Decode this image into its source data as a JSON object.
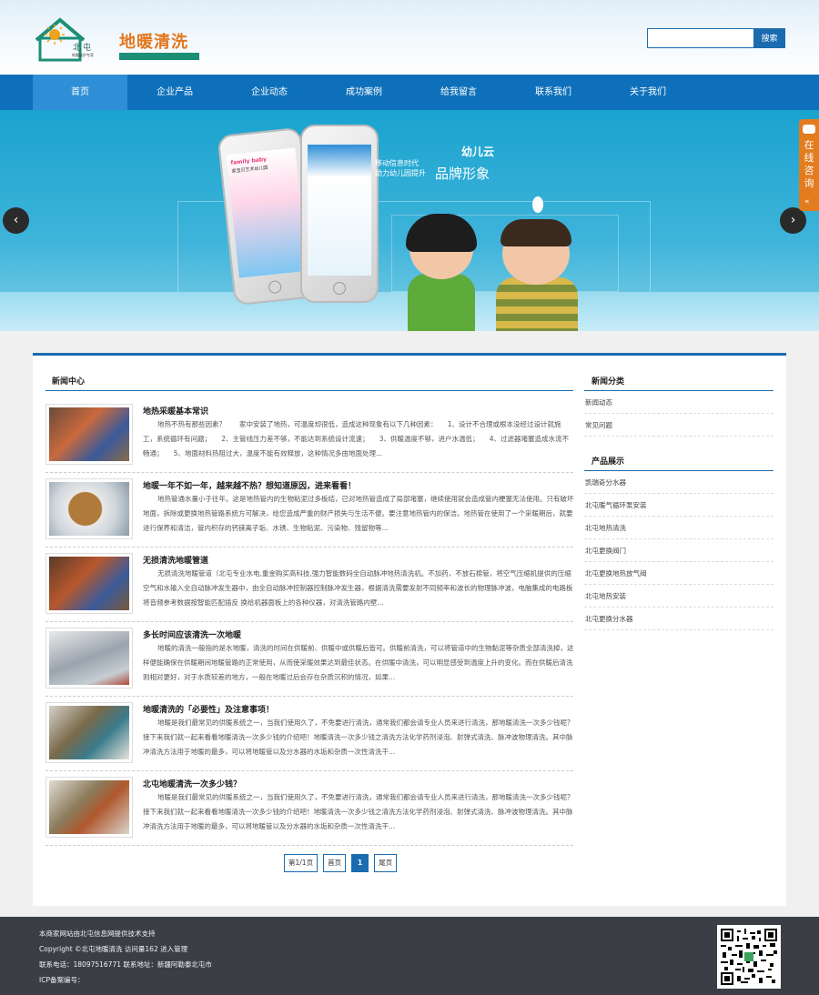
{
  "header": {
    "logo_text": "北屯",
    "logo_subtext": "地暖维护专家",
    "brand": "地暖清洗",
    "search": {
      "placeholder": "",
      "button_label": "搜索"
    }
  },
  "nav": {
    "items": [
      "首页",
      "企业产品",
      "企业动态",
      "成功案例",
      "给我留言",
      "联系我们",
      "关于我们"
    ],
    "active": "首页"
  },
  "banner": {
    "brand": "幼儿云",
    "slogan_line1": "移动信息时代",
    "slogan_line2": "助力幼儿园提升",
    "slogan_highlight": "品牌形象",
    "phone_title": "family baby",
    "phone_subtitle": "家宝贝艺术幼儿园"
  },
  "consult": {
    "label": "在线咨询",
    "arrow": "«"
  },
  "news_section": {
    "title": "新闻中心"
  },
  "news": [
    {
      "title": "地热采暖基本常识",
      "desc": "地热不热有那些因素？　　家中安装了地热，可温度却很低，造成这种现象有以下几种因素：　　1、设计不合理或根本没经过设计就施工，系统循环有问题；　　2、主管线压力差不够，不能达到系统设计流速；　　3、供暖温度不够，进户水温低；　　4、过滤器堵塞造成水流不畅通；　　5、地面材料热阻过大，温度不能有效释放，这种情况多由地面处理..."
    },
    {
      "title": "地暖一年不如一年，越来越不热？想知道原因，进来看看！",
      "desc": "地热管通水量小于往年。这是地热管内的生物粘泥过多板结，已对地热管造成了局部堵塞，继续使用就会造成管内梗塞无法使用。只有破坏地面，拆除或更换地热管路系统方可解决，给您造成严重的财产损失与生活不便。要注意地热管内的保洁。地热管在使用了一个采暖期后，就要进行保养和清洁，管内积存的钙镁离子垢、水锈、生物粘泥、污染物、残留物等..."
    },
    {
      "title": "无损清洗地暖管道",
      "desc": "无损清洗地暖管道（北屯专业水电,重金购买高科技,强力智能数码全自动脉冲地热清洗机。不加药，不放石棉管，将空气压缩机提供的压缩空气和水输入全自动脉冲发生器中，由全自动脉冲控制器控制脉冲发生器，根据清洗需要发射不同频率和波长的物理脉冲波，电脑集成的电路板将音频参考数据按智能匹配插反 换给机器面板上的各种仪器，对清洗管路内壁..."
    },
    {
      "title": "多长时间应该清洗一次地暖",
      "desc": "地暖的清洗一般指的是水地暖，清洗的时间在供暖前、供暖中或供暖后皆可。供暖前清洗，可以将管道中的生物黏泥等杂质全部清洗掉，这样便能确保在供暖期间地暖管路的正常使用，从而使采暖效果达到最佳状态。在供暖中清洗，可以明显感受到温度上升的变化。而在供暖后清洗则相对更好，对于水质较差的地方，一般在地暖过后会存在杂质沉积的情况，如果..."
    },
    {
      "title": "地暖清洗的「必要性」及注意事项！",
      "desc": "地暖是我们最常见的供暖系统之一，当我们使用久了，不免要进行清洗，通常我们都会请专业人员来进行清洗，那地暖清洗一次多少钱呢？接下来我们就一起来看看地暖清洗一次多少钱的介绍吧！地暖清洗一次多少钱之清洗方法化学药剂浸泡、射弹式清洗、脉冲波物理清洗。其中脉冲清洗方法用于地暖的最多，可以将地暖管以及分水器的水垢和杂质一次性清洗干..."
    },
    {
      "title": "北屯地暖清洗一次多少钱？",
      "desc": "地暖是我们最常见的供暖系统之一，当我们使用久了，不免要进行清洗，通常我们都会请专业人员来进行清洗，那地暖清洗一次多少钱呢？接下来我们就一起来看看地暖清洗一次多少钱的介绍吧！地暖清洗一次多少钱之清洗方法化学药剂浸泡、射弹式清洗、脉冲波物理清洗。其中脉冲清洗方法用于地暖的最多，可以将地暖管以及分水器的水垢和杂质一次性清洗干..."
    }
  ],
  "pager": {
    "info": "第1/1页",
    "first": "首页",
    "current": "1",
    "last": "尾页"
  },
  "sidebar": {
    "news_categories": {
      "title": "新闻分类",
      "items": [
        "新闻动态",
        "常见问题"
      ]
    },
    "products": {
      "title": "产品展示",
      "items": [
        "凯瑞奇分水器",
        "北屯暖气循环泵安装",
        "北屯地热清洗",
        "北屯更换阀门",
        "北屯更换地热放气阀",
        "北屯地热安装",
        "北屯更换分水器"
      ]
    }
  },
  "footer": {
    "line1": "本商家网站由北屯信息网提供技术支持",
    "line2": "Copyright ©北屯地暖清洗 访问量162 进入管理",
    "line3": "联系电话：18097516771 联系地址：新疆阿勒泰北屯市",
    "line4": "ICP备案编号："
  },
  "colors": {
    "primary": "#0e70ba",
    "accent": "#e37b1f",
    "footer_bg": "#3b3f45"
  }
}
